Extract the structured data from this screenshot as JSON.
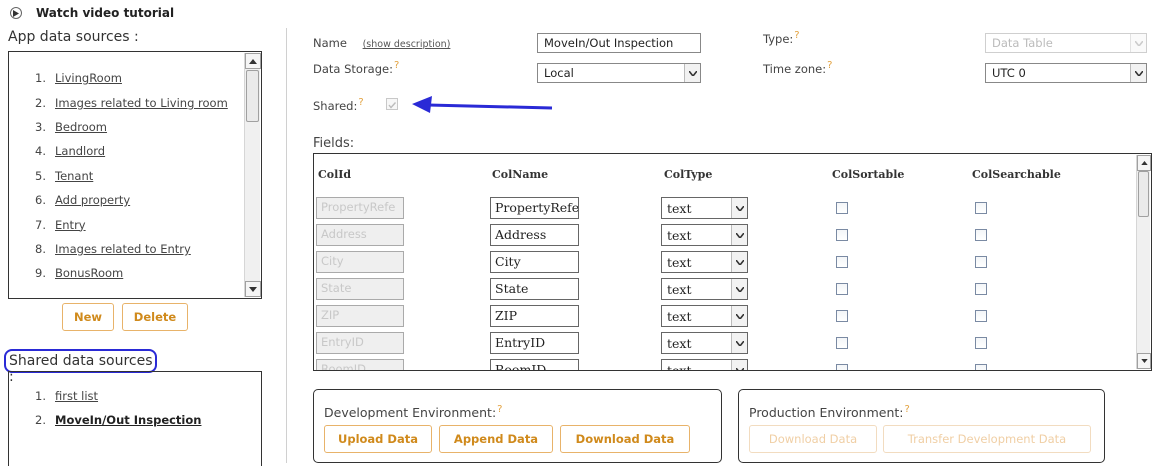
{
  "tutorial": {
    "label": "Watch video tutorial"
  },
  "app_sources": {
    "title": "App data sources :",
    "items": [
      {
        "num": "1.",
        "label": "LivingRoom"
      },
      {
        "num": "2.",
        "label": "Images related to Living room"
      },
      {
        "num": "3.",
        "label": "Bedroom"
      },
      {
        "num": "4.",
        "label": "Landlord"
      },
      {
        "num": "5.",
        "label": "Tenant"
      },
      {
        "num": "6.",
        "label": "Add property"
      },
      {
        "num": "7.",
        "label": "Entry"
      },
      {
        "num": "8.",
        "label": "Images related to Entry"
      },
      {
        "num": "9.",
        "label": "BonusRoom"
      }
    ],
    "new_label": "New",
    "delete_label": "Delete"
  },
  "shared_sources": {
    "title": "Shared data sources :",
    "items": [
      {
        "num": "1.",
        "label": "first list"
      },
      {
        "num": "2.",
        "label": "MoveIn/Out Inspection"
      }
    ]
  },
  "form": {
    "name_label": "Name",
    "show_description": "(show description)",
    "name_value": "MoveIn/Out Inspection",
    "type_label": "Type:",
    "type_value": "Data Table",
    "storage_label": "Data Storage:",
    "storage_value": "Local",
    "timezone_label": "Time zone:",
    "timezone_value": "UTC 0",
    "shared_label": "Shared:",
    "shared_checked": true,
    "help_mark": "?",
    "fields_label": "Fields:"
  },
  "fields": {
    "headers": [
      "ColId",
      "ColName",
      "ColType",
      "ColSortable",
      "ColSearchable"
    ],
    "rows": [
      {
        "colid": "PropertyRefe",
        "colname": "PropertyRefe",
        "coltype": "text"
      },
      {
        "colid": "Address",
        "colname": "Address",
        "coltype": "text"
      },
      {
        "colid": "City",
        "colname": "City",
        "coltype": "text"
      },
      {
        "colid": "State",
        "colname": "State",
        "coltype": "text"
      },
      {
        "colid": "ZIP",
        "colname": "ZIP",
        "coltype": "text"
      },
      {
        "colid": "EntryID",
        "colname": "EntryID",
        "coltype": "text"
      },
      {
        "colid": "RoomID",
        "colname": "RoomID",
        "coltype": "text"
      }
    ]
  },
  "dev_env": {
    "title": "Development Environment:",
    "upload": "Upload Data",
    "append": "Append Data",
    "download": "Download Data"
  },
  "prod_env": {
    "title": "Production Environment:",
    "download": "Download Data",
    "transfer": "Transfer Development Data"
  },
  "colors": {
    "accent": "#e2a240",
    "highlight": "#2a2ad6"
  }
}
